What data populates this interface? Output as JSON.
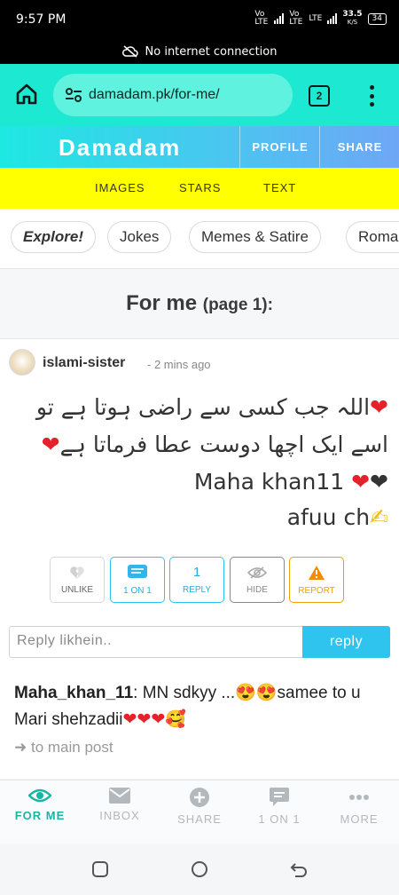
{
  "status_bar": {
    "time": "9:57 PM",
    "net1": "Vo LTE",
    "net2": "Vo LTE",
    "net3": "LTE",
    "speed_value": "33.5",
    "speed_unit": "K/S",
    "battery": "34"
  },
  "notice": {
    "text": "No internet connection",
    "icon": "cloud-off-icon"
  },
  "browser": {
    "url": "damadam.pk/for-me/",
    "tab_count": "2"
  },
  "site": {
    "logo": "Damadam",
    "profile_label": "PROFILE",
    "share_label": "SHARE"
  },
  "yellow_nav": {
    "images": "IMAGES",
    "stars": "STARS",
    "text": "TEXT"
  },
  "chips": [
    "Explore!",
    "Jokes",
    "Memes & Satire",
    "Roma"
  ],
  "heading": {
    "main": "For me",
    "sub": "(page 1):"
  },
  "post": {
    "username": "islami-sister",
    "time_ago": "- 2 mins ago",
    "line1": "اللہ جب کسی سے راضی ہوتا ہے تو",
    "line2": "اسے ایک اچھا دوست عطا فرماتا ہے",
    "line3": "Maha khan11",
    "line4": "afuu ch",
    "actions": {
      "unlike": "UNLIKE",
      "one_on_one": "1 ON 1",
      "reply_count": "1",
      "reply": "REPLY",
      "hide": "HIDE",
      "report": "REPORT"
    },
    "reply_placeholder": "Reply likhein..",
    "reply_button": "reply",
    "reply_user": "Maha_khan_11",
    "reply_text_a": ": MN sdkyy ...",
    "reply_text_b": "samee to u Mari shehzadii",
    "to_main": "to main post"
  },
  "bottom_nav": {
    "for_me": "FOR ME",
    "inbox": "INBOX",
    "share": "SHARE",
    "one_on_one": "1 ON 1",
    "more": "MORE"
  },
  "colors": {
    "accent": "#1de9d2",
    "reply_button": "#2ec4ee",
    "yellow_bar": "#ffff00",
    "report": "#f0a000",
    "active_tab": "#19b6a6"
  }
}
